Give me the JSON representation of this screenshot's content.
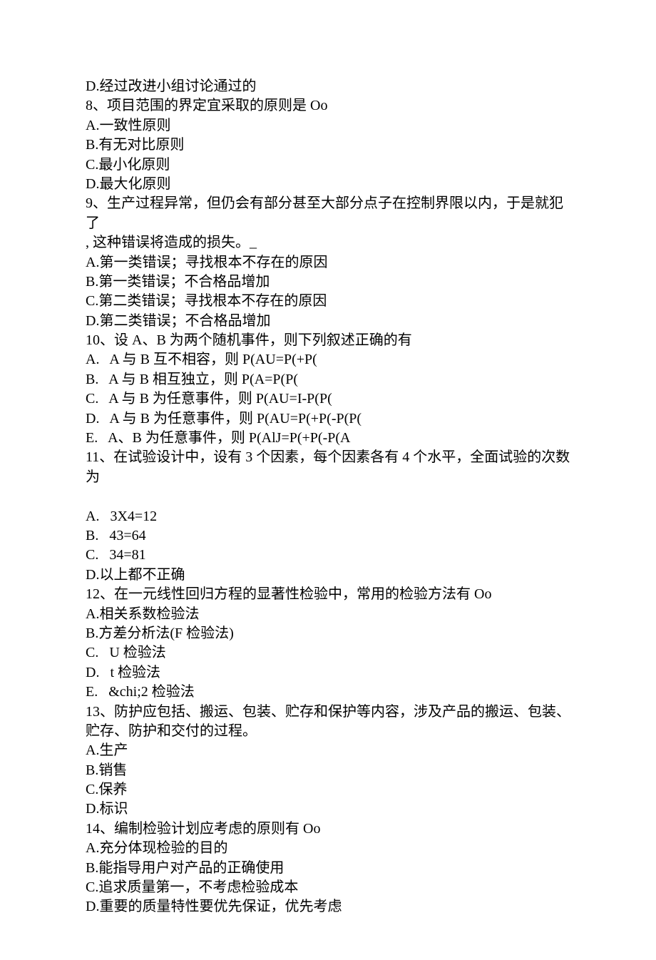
{
  "lines": [
    "D.经过改进小组讨论通过的",
    "8、项目范围的界定宜采取的原则是 Oo",
    "A.一致性原则",
    "B.有无对比原则",
    "C.最小化原则",
    "D.最大化原则",
    "9、生产过程异常，但仍会有部分甚至大部分点子在控制界限以内，于是就犯了",
    ", 这种错误将造成的损失。_",
    "A.第一类错误；寻找根本不存在的原因",
    "B.第一类错误；不合格品增加",
    "C.第二类错误；寻找根本不存在的原因",
    "D.第二类错误；不合格品增加",
    "10、设 A、B 为两个随机事件，则下列叙述正确的有",
    "A.   A 与 B 互不相容，则 P(AU=P(+P(",
    "B.   A 与 B 相互独立，则 P(A=P(P(",
    "C.   A 与 B 为任意事件，则 P(AU=I-P(P(",
    "D.   A 与 B 为任意事件，则 P(AU=P(+P(-P(P(",
    "E.   A、B 为任意事件，则 P(AlJ=P(+P(-P(A",
    "11、在试验设计中，设有 3 个因素，每个因素各有 4 个水平，全面试验的次数",
    "为",
    "",
    "A.   3X4=12",
    "B.   43=64",
    "C.   34=81",
    "D.以上都不正确",
    "12、在一元线性回归方程的显著性检验中，常用的检验方法有 Oo",
    "A.相关系数检验法",
    "B.方差分析法(F 检验法)",
    "C.   U 检验法",
    "D.   t 检验法",
    "E.   &chi;2 检验法",
    "13、防护应包括、搬运、包装、贮存和保护等内容，涉及产品的搬运、包装、",
    "贮存、防护和交付的过程。",
    "A.生产",
    "B.销售",
    "C.保养",
    "D.标识",
    "14、编制检验计划应考虑的原则有 Oo",
    "A.充分体现检验的目的",
    "B.能指导用户对产品的正确使用",
    "C.追求质量第一，不考虑检验成本",
    "D.重要的质量特性要优先保证，优先考虑"
  ]
}
